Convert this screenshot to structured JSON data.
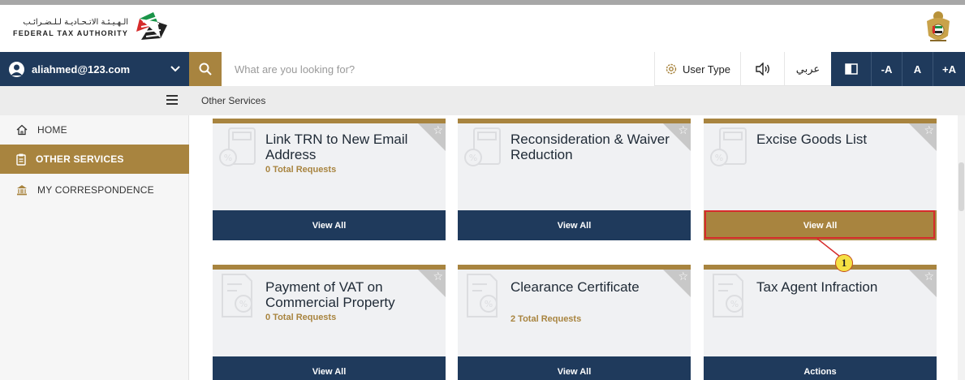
{
  "header": {
    "logo_arabic": "الـهـيـئـة الاتـحـاديـة لـلـضـرائـب",
    "logo_english": "FEDERAL TAX AUTHORITY"
  },
  "navbar": {
    "user_email": "aliahmed@123.com",
    "search_placeholder": "What are you looking for?",
    "user_type_label": "User Type",
    "language_label": "عربي",
    "font_decrease": "-A",
    "font_reset": "A",
    "font_increase": "+A"
  },
  "breadcrumb": "Other Services",
  "sidebar": {
    "items": [
      {
        "label": "HOME",
        "icon": "home-icon",
        "active": false
      },
      {
        "label": "OTHER SERVICES",
        "icon": "clipboard-icon",
        "active": true
      },
      {
        "label": "MY CORRESPONDENCE",
        "icon": "bank-icon",
        "active": false
      }
    ]
  },
  "cards": [
    {
      "title": "Link TRN to New Email Address",
      "count": "0 Total Requests",
      "button": "View All"
    },
    {
      "title": "Reconsideration & Waiver Reduction",
      "count": "",
      "button": "View All"
    },
    {
      "title": "Excise Goods List",
      "count": "",
      "button": "View All",
      "highlighted": true
    },
    {
      "title": "Payment of VAT on Commercial Property",
      "count": "0 Total Requests",
      "button": "View All"
    },
    {
      "title": "Clearance Certificate",
      "count": "2 Total Requests",
      "button": "View All"
    },
    {
      "title": "Tax Agent Infraction",
      "count": "",
      "button": "Actions"
    }
  ],
  "annotation": {
    "callout_number": "1"
  },
  "colors": {
    "navy": "#1f3a5c",
    "gold": "#a8843f",
    "highlight": "#d62b2b",
    "callout_fill": "#f5e043"
  }
}
